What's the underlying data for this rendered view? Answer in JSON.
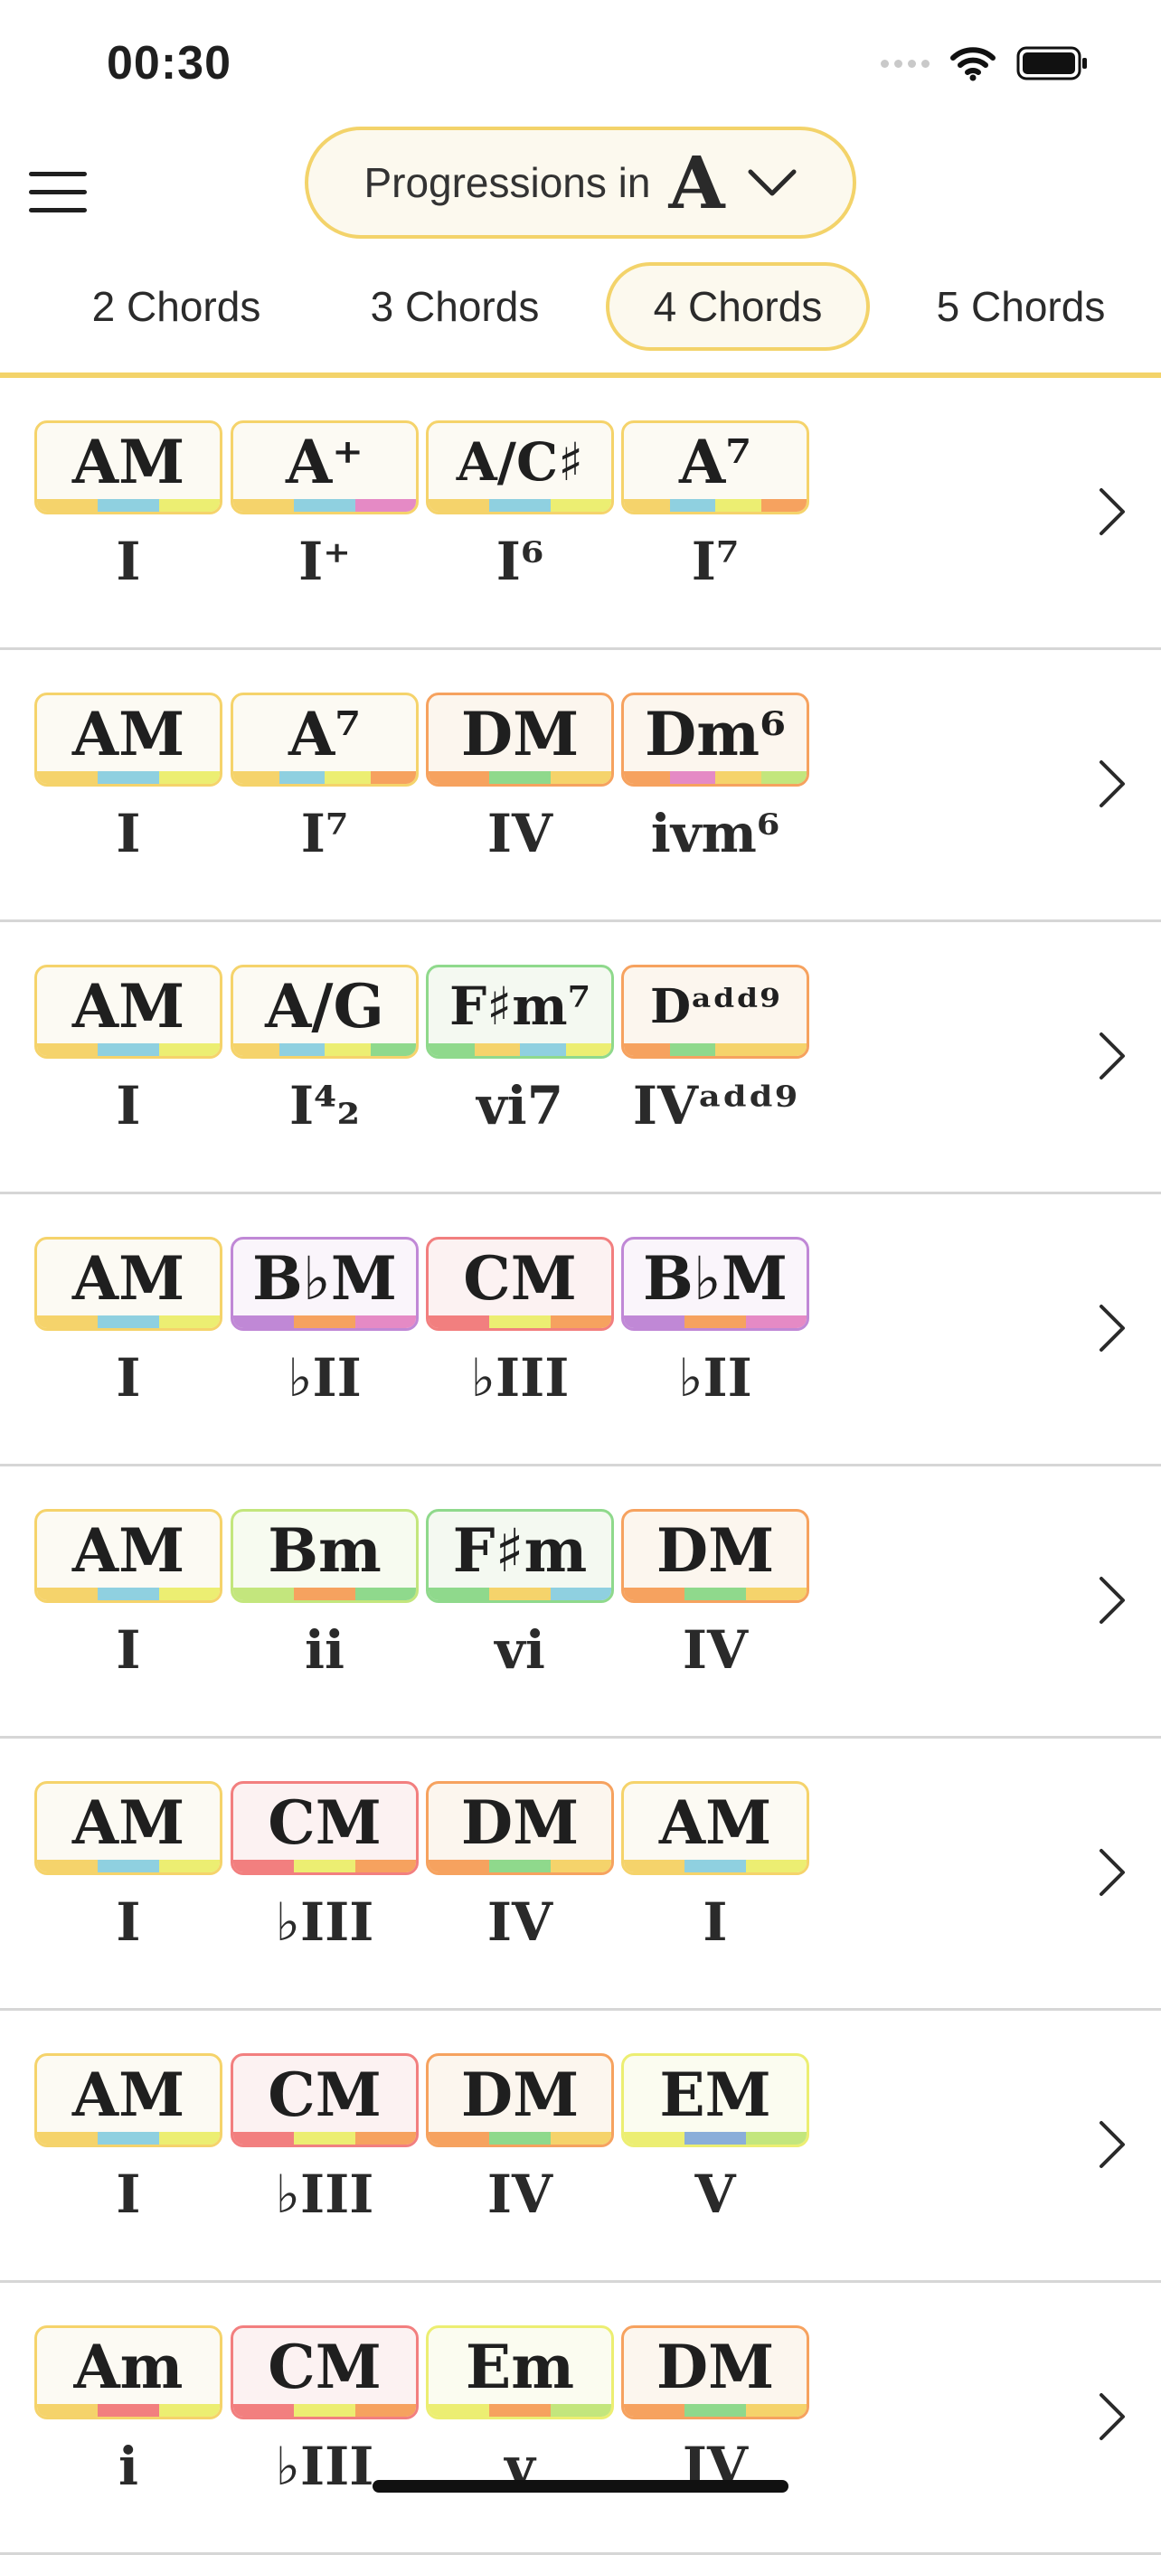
{
  "status_bar": {
    "time": "00:30"
  },
  "header": {
    "key_prefix": "Progressions in",
    "key": "A"
  },
  "tabs": [
    {
      "label": "2 Chords"
    },
    {
      "label": "3 Chords"
    },
    {
      "label": "4 Chords",
      "active": true
    },
    {
      "label": "5 Chords"
    }
  ],
  "colors": {
    "yellow": "#f5d36b",
    "cyan": "#8fd0e0",
    "lime": "#ecee72",
    "pink": "#e58ac5",
    "orange": "#f6a25f",
    "green": "#8fd98c",
    "light_green": "#c3e67d",
    "purple": "#c088d6",
    "red": "#f27f7f",
    "blue": "#8aaed9",
    "accent": "#f3d36a"
  },
  "progressions": [
    {
      "chords": [
        {
          "name": "AM",
          "roman": "I",
          "border": "yellow",
          "bg": "#fcfaf3",
          "stripe": [
            "yellow",
            "cyan",
            "lime"
          ]
        },
        {
          "name": "A⁺",
          "roman": "I⁺",
          "border": "yellow",
          "bg": "#fcfaf3",
          "stripe": [
            "yellow",
            "cyan",
            "pink"
          ]
        },
        {
          "name": "A/C♯",
          "roman": "I⁶",
          "border": "yellow",
          "bg": "#fcfaf3",
          "stripe": [
            "yellow",
            "cyan",
            "lime"
          ]
        },
        {
          "name": "A⁷",
          "roman": "I⁷",
          "border": "yellow",
          "bg": "#fcfaf3",
          "stripe": [
            "yellow",
            "cyan",
            "lime",
            "orange"
          ]
        }
      ]
    },
    {
      "chords": [
        {
          "name": "AM",
          "roman": "I",
          "border": "yellow",
          "bg": "#fcfaf3",
          "stripe": [
            "yellow",
            "cyan",
            "lime"
          ]
        },
        {
          "name": "A⁷",
          "roman": "I⁷",
          "border": "yellow",
          "bg": "#fcfaf3",
          "stripe": [
            "yellow",
            "cyan",
            "lime",
            "orange"
          ]
        },
        {
          "name": "DM",
          "roman": "IV",
          "border": "orange",
          "bg": "#fcf6ee",
          "stripe": [
            "orange",
            "green",
            "yellow"
          ]
        },
        {
          "name": "Dm⁶",
          "roman": "ivm⁶",
          "border": "orange",
          "bg": "#fcf6ee",
          "stripe": [
            "orange",
            "pink",
            "yellow",
            "light_green"
          ]
        }
      ]
    },
    {
      "chords": [
        {
          "name": "AM",
          "roman": "I",
          "border": "yellow",
          "bg": "#fcfaf3",
          "stripe": [
            "yellow",
            "cyan",
            "lime"
          ]
        },
        {
          "name": "A/G",
          "roman": "I⁴₂",
          "border": "yellow",
          "bg": "#fcfaf3",
          "stripe": [
            "yellow",
            "cyan",
            "lime",
            "green"
          ]
        },
        {
          "name": "F♯m⁷",
          "roman": "vi7",
          "border": "green",
          "bg": "#f4f9f1",
          "stripe": [
            "green",
            "yellow",
            "cyan",
            "lime"
          ]
        },
        {
          "name": "Dᵃᵈᵈ⁹",
          "roman": "IVᵃᵈᵈ⁹",
          "border": "orange",
          "bg": "#fcf6ee",
          "stripe": [
            "orange",
            "green",
            "yellow",
            "yellow"
          ]
        }
      ]
    },
    {
      "chords": [
        {
          "name": "AM",
          "roman": "I",
          "border": "yellow",
          "bg": "#fcfaf3",
          "stripe": [
            "yellow",
            "cyan",
            "lime"
          ]
        },
        {
          "name": "B♭M",
          "roman": "♭II",
          "border": "purple",
          "bg": "#faf5fb",
          "stripe": [
            "purple",
            "orange",
            "pink"
          ]
        },
        {
          "name": "CM",
          "roman": "♭III",
          "border": "red",
          "bg": "#fcf2f2",
          "stripe": [
            "red",
            "lime",
            "orange"
          ]
        },
        {
          "name": "B♭M",
          "roman": "♭II",
          "border": "purple",
          "bg": "#faf5fb",
          "stripe": [
            "purple",
            "orange",
            "pink"
          ]
        }
      ]
    },
    {
      "chords": [
        {
          "name": "AM",
          "roman": "I",
          "border": "yellow",
          "bg": "#fcfaf3",
          "stripe": [
            "yellow",
            "cyan",
            "lime"
          ]
        },
        {
          "name": "Bm",
          "roman": "ii",
          "border": "light_green",
          "bg": "#f7fbf0",
          "stripe": [
            "light_green",
            "orange",
            "green"
          ]
        },
        {
          "name": "F♯m",
          "roman": "vi",
          "border": "green",
          "bg": "#f4f9f1",
          "stripe": [
            "green",
            "yellow",
            "cyan"
          ]
        },
        {
          "name": "DM",
          "roman": "IV",
          "border": "orange",
          "bg": "#fcf6ee",
          "stripe": [
            "orange",
            "green",
            "yellow"
          ]
        }
      ]
    },
    {
      "chords": [
        {
          "name": "AM",
          "roman": "I",
          "border": "yellow",
          "bg": "#fcfaf3",
          "stripe": [
            "yellow",
            "cyan",
            "lime"
          ]
        },
        {
          "name": "CM",
          "roman": "♭III",
          "border": "red",
          "bg": "#fcf2f2",
          "stripe": [
            "red",
            "lime",
            "orange"
          ]
        },
        {
          "name": "DM",
          "roman": "IV",
          "border": "orange",
          "bg": "#fcf6ee",
          "stripe": [
            "orange",
            "green",
            "yellow"
          ]
        },
        {
          "name": "AM",
          "roman": "I",
          "border": "yellow",
          "bg": "#fcfaf3",
          "stripe": [
            "yellow",
            "cyan",
            "lime"
          ]
        }
      ]
    },
    {
      "chords": [
        {
          "name": "AM",
          "roman": "I",
          "border": "yellow",
          "bg": "#fcfaf3",
          "stripe": [
            "yellow",
            "cyan",
            "lime"
          ]
        },
        {
          "name": "CM",
          "roman": "♭III",
          "border": "red",
          "bg": "#fcf2f2",
          "stripe": [
            "red",
            "lime",
            "orange"
          ]
        },
        {
          "name": "DM",
          "roman": "IV",
          "border": "orange",
          "bg": "#fcf6ee",
          "stripe": [
            "orange",
            "green",
            "yellow"
          ]
        },
        {
          "name": "EM",
          "roman": "V",
          "border": "lime",
          "bg": "#fbfcf0",
          "stripe": [
            "lime",
            "blue",
            "light_green"
          ]
        }
      ]
    },
    {
      "chords": [
        {
          "name": "Am",
          "roman": "i",
          "border": "yellow",
          "bg": "#fcfaf3",
          "stripe": [
            "yellow",
            "red",
            "lime"
          ]
        },
        {
          "name": "CM",
          "roman": "♭III",
          "border": "red",
          "bg": "#fcf2f2",
          "stripe": [
            "red",
            "lime",
            "orange"
          ]
        },
        {
          "name": "Em",
          "roman": "v",
          "border": "lime",
          "bg": "#fbfcf0",
          "stripe": [
            "lime",
            "orange",
            "light_green"
          ]
        },
        {
          "name": "DM",
          "roman": "IV",
          "border": "orange",
          "bg": "#fcf6ee",
          "stripe": [
            "orange",
            "green",
            "yellow"
          ]
        }
      ]
    }
  ]
}
